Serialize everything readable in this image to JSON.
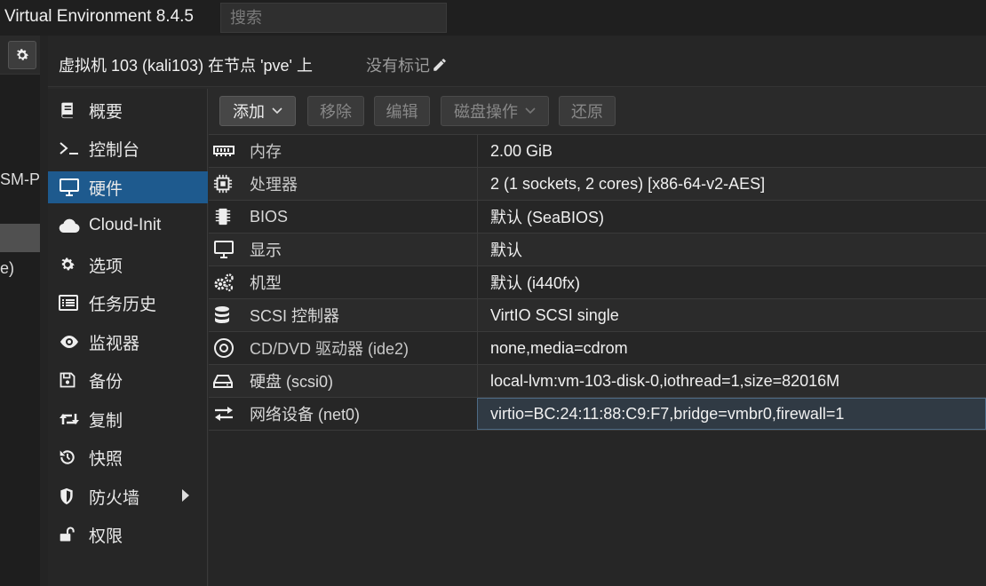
{
  "app": {
    "title": "Virtual Environment 8.4.5",
    "search_placeholder": "搜索"
  },
  "tree": {
    "partial_1": "SM-P",
    "partial_2": "e)"
  },
  "header": {
    "title": "虚拟机 103 (kali103) 在节点 'pve' 上",
    "tags": "没有标记"
  },
  "nav": {
    "items": [
      {
        "label": "概要",
        "icon": "book-icon"
      },
      {
        "label": "控制台",
        "icon": "terminal-icon"
      },
      {
        "label": "硬件",
        "icon": "desktop-icon",
        "active": true
      },
      {
        "label": "Cloud-Init",
        "icon": "cloud-icon"
      },
      {
        "label": "选项",
        "icon": "gear-icon"
      },
      {
        "label": "任务历史",
        "icon": "list-icon"
      },
      {
        "label": "监视器",
        "icon": "eye-icon"
      },
      {
        "label": "备份",
        "icon": "floppy-icon"
      },
      {
        "label": "复制",
        "icon": "retweet-icon"
      },
      {
        "label": "快照",
        "icon": "history-icon"
      },
      {
        "label": "防火墙",
        "icon": "shield-icon",
        "has_submenu": true
      },
      {
        "label": "权限",
        "icon": "unlock-icon"
      }
    ]
  },
  "toolbar": {
    "add": "添加",
    "remove": "移除",
    "edit": "编辑",
    "disk_action": "磁盘操作",
    "revert": "还原"
  },
  "hardware": {
    "rows": [
      {
        "name": "内存",
        "value": "2.00 GiB",
        "icon": "memory-icon"
      },
      {
        "name": "处理器",
        "value": "2 (1 sockets, 2 cores) [x86-64-v2-AES]",
        "icon": "cpu-icon"
      },
      {
        "name": "BIOS",
        "value": "默认 (SeaBIOS)",
        "icon": "chip-icon"
      },
      {
        "name": "显示",
        "value": "默认",
        "icon": "desktop-icon"
      },
      {
        "name": "机型",
        "value": "默认 (i440fx)",
        "icon": "cogs-icon"
      },
      {
        "name": "SCSI 控制器",
        "value": "VirtIO SCSI single",
        "icon": "database-icon"
      },
      {
        "name": "CD/DVD 驱动器 (ide2)",
        "value": "none,media=cdrom",
        "icon": "cdrom-icon"
      },
      {
        "name": "硬盘 (scsi0)",
        "value": "local-lvm:vm-103-disk-0,iothread=1,size=82016M",
        "icon": "hdd-icon"
      },
      {
        "name": "网络设备 (net0)",
        "value": "virtio=BC:24:11:88:C9:F7,bridge=vmbr0,firewall=1",
        "icon": "exchange-icon",
        "selected": true
      }
    ]
  }
}
